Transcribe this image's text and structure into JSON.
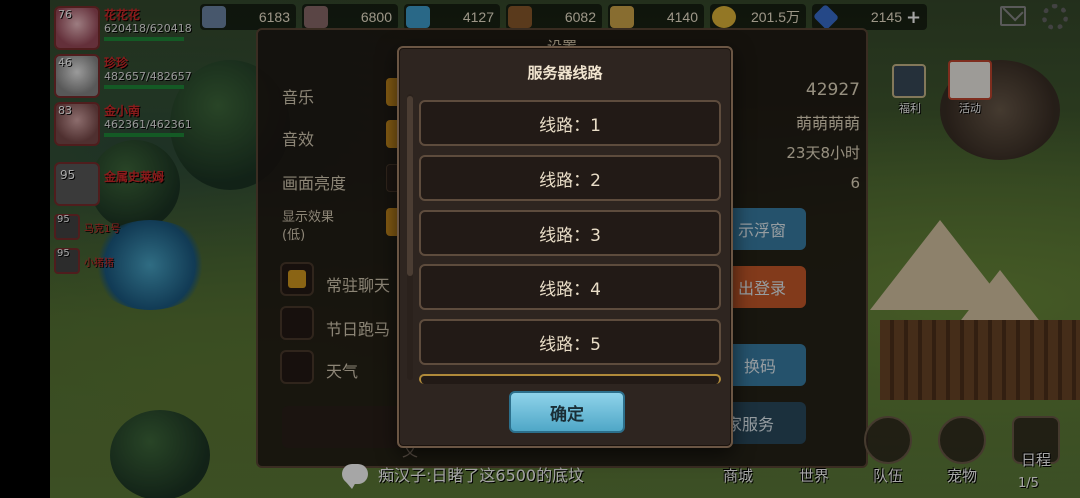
{
  "resources": [
    {
      "icon": "stone-icon",
      "value": "6183",
      "color": "#6d86a6"
    },
    {
      "icon": "ore-icon",
      "value": "6800",
      "color": "#8a6b6b"
    },
    {
      "icon": "crystal-icon",
      "value": "4127",
      "color": "#3fa0d0"
    },
    {
      "icon": "wood-icon",
      "value": "6082",
      "color": "#8b5a2b"
    },
    {
      "icon": "wheat-icon",
      "value": "4140",
      "color": "#d2a84a"
    },
    {
      "icon": "gold-coin-icon",
      "value": "201.5万",
      "color": "#e2b73a"
    },
    {
      "icon": "diamond-icon",
      "value": "2145",
      "color": "#3a6fd0"
    }
  ],
  "party": [
    {
      "level": "76",
      "name": "花花花",
      "hp": "620418/620418"
    },
    {
      "level": "46",
      "name": "珍珍",
      "hp": "482657/482657"
    },
    {
      "level": "83",
      "name": "金小南",
      "hp": "462361/462361"
    },
    {
      "level": "95",
      "name": "金属史莱姆",
      "hp": ""
    }
  ],
  "party_small": [
    {
      "level": "95",
      "name": "马克1号"
    },
    {
      "level": "95",
      "name": "小猪猪"
    }
  ],
  "activities": [
    {
      "label": "福利",
      "icon": "welfare-icon"
    },
    {
      "label": "活动",
      "icon": "calendar-icon"
    }
  ],
  "settings": {
    "title": "设置",
    "music": "音乐",
    "sound": "音效",
    "brightness": "画面亮度",
    "display_effect": "显示效果",
    "display_effect_value": "(低)",
    "resident_chat": "常驻聊天",
    "holiday_marquee": "节日跑马",
    "weather": "天气",
    "player_id": "42927",
    "player_name": "萌萌萌萌",
    "play_time": "23天8小时",
    "server_num": "6",
    "float_window_btn": "示浮窗",
    "login_btn": "出登录",
    "redeem_btn": "换码",
    "service_btn": "玩家服务",
    "copy_btn": "制ID文"
  },
  "chat": {
    "message": "痴汉子:日睹了这6500的底坟"
  },
  "nav": [
    {
      "label": "商城",
      "icon": "shop-icon"
    },
    {
      "label": "世界",
      "icon": "world-icon"
    },
    {
      "label": "队伍",
      "icon": "team-icon"
    },
    {
      "label": "宠物",
      "icon": "pet-paw-icon"
    },
    {
      "label": "日程",
      "icon": "schedule-icon"
    }
  ],
  "schedule_count": "1/5",
  "server_dialog": {
    "title": "服务器线路",
    "lines": [
      "线路：1",
      "线路：2",
      "线路：3",
      "线路：4",
      "线路：5"
    ],
    "confirm_label": "确定"
  }
}
